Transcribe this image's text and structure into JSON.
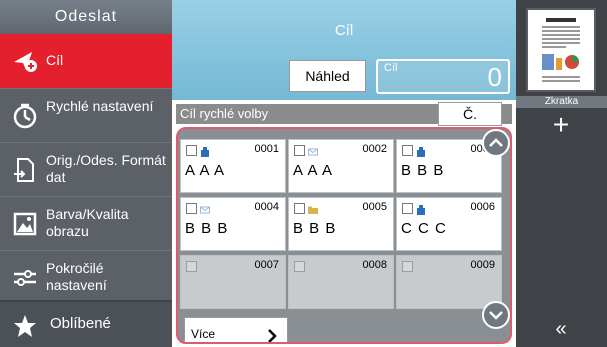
{
  "sidebar": {
    "title": "Odeslat",
    "items": [
      {
        "label": "Cíl",
        "icon": "send-target-icon",
        "active": true
      },
      {
        "label": "Rychlé nastavení",
        "icon": "quick-setup-icon"
      },
      {
        "label": "Orig./Odes. Formát dat",
        "icon": "original-format-icon"
      },
      {
        "label": "Barva/Kvalita obrazu",
        "icon": "image-quality-icon"
      },
      {
        "label": "Pokročilé nastavení",
        "icon": "advanced-settings-icon"
      }
    ],
    "favorites": {
      "label": "Oblíbené",
      "icon": "star-icon"
    }
  },
  "main": {
    "title": "Cíl",
    "preview_button": "Náhled",
    "count_label": "Cíl",
    "count_value": "0",
    "quick_dial": {
      "label": "Cíl rychlé volby",
      "number_button": "Č."
    },
    "grid": [
      [
        {
          "num": "0001",
          "name": "A A A",
          "type": "group"
        },
        {
          "num": "0002",
          "name": "A A A",
          "type": "email"
        },
        {
          "num": "0003",
          "name": "B B B",
          "type": "group"
        }
      ],
      [
        {
          "num": "0004",
          "name": "B B B",
          "type": "email"
        },
        {
          "num": "0005",
          "name": "B B B",
          "type": "folder"
        },
        {
          "num": "0006",
          "name": "C C C",
          "type": "group"
        }
      ],
      [
        {
          "num": "0007",
          "name": "",
          "type": "empty"
        },
        {
          "num": "0008",
          "name": "",
          "type": "empty"
        },
        {
          "num": "0009",
          "name": "",
          "type": "empty"
        }
      ]
    ],
    "more_button": "Více",
    "accent_color": "#e5202e"
  },
  "right_panel": {
    "shortcut_label": "Zkratka",
    "plus_label": "+",
    "collapse_label": "«"
  }
}
